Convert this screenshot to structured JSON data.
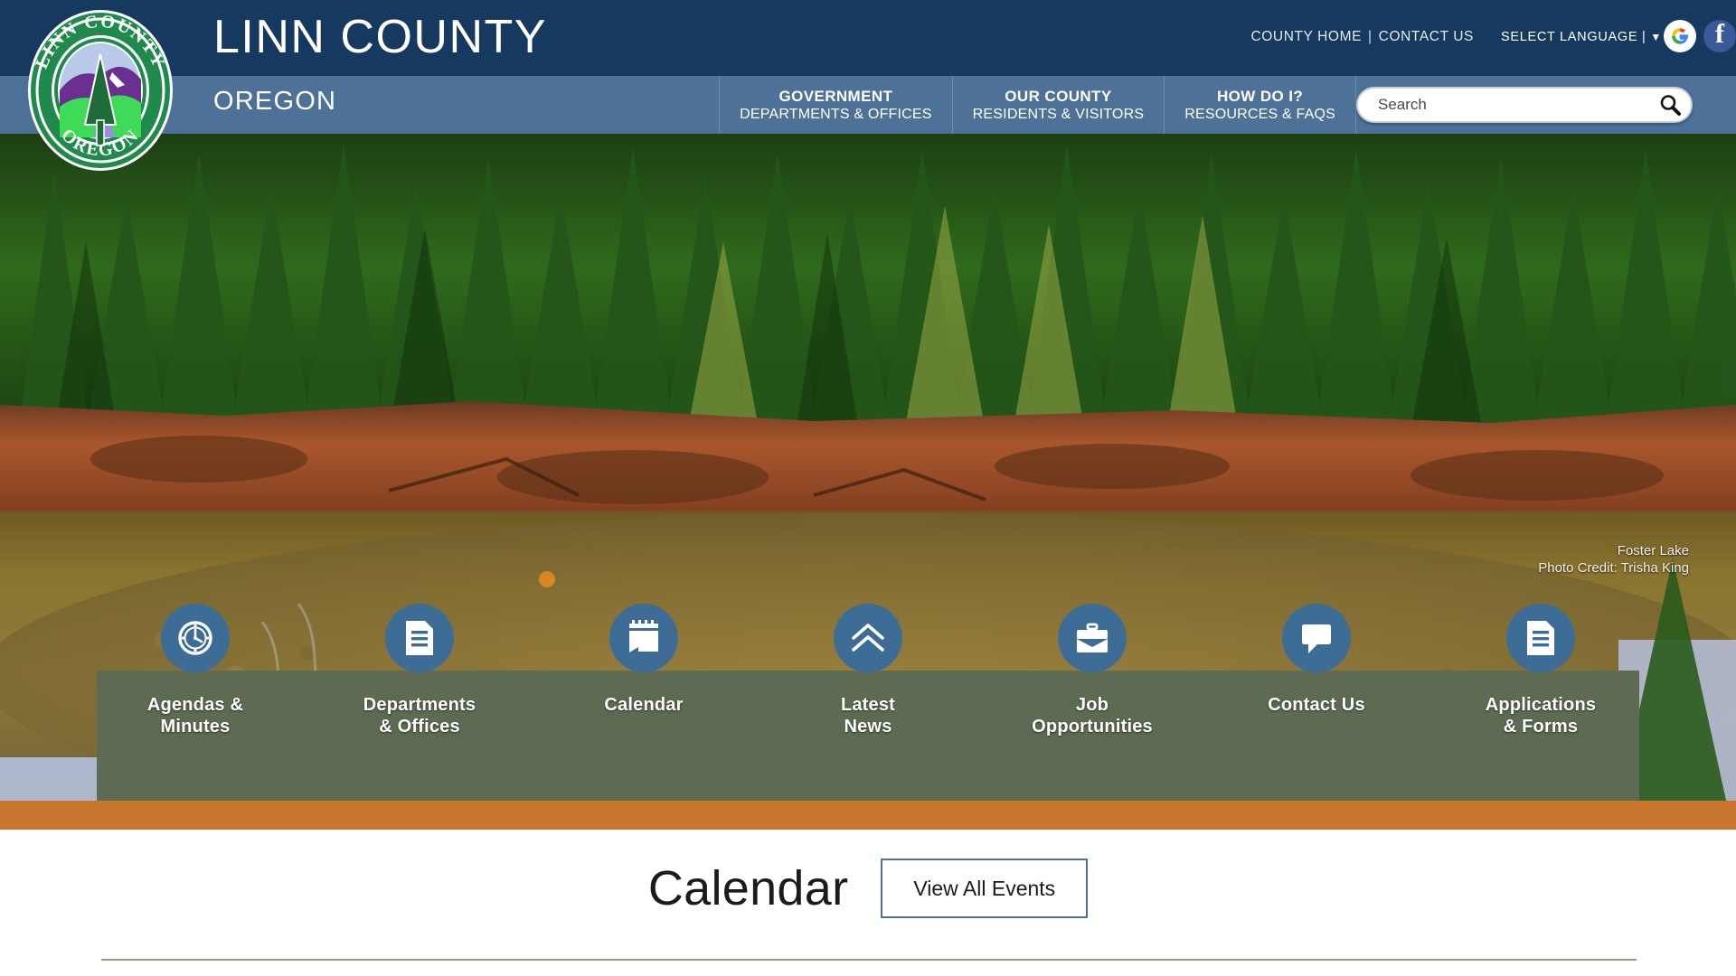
{
  "header": {
    "site_title": "LINN COUNTY",
    "site_subtitle": "OREGON",
    "utility_links": [
      {
        "label": "COUNTY HOME"
      },
      {
        "label": "CONTACT US"
      }
    ],
    "utility_separator": "|",
    "language_label": "SELECT LANGUAGE |",
    "language_caret": "▼",
    "social": [
      {
        "name": "google-icon",
        "label": "G"
      },
      {
        "name": "facebook-icon",
        "label": "f"
      }
    ],
    "seal": {
      "top_text": "LINN COUNTY",
      "bottom_text": "OREGON"
    }
  },
  "nav": {
    "items": [
      {
        "title": "GOVERNMENT",
        "subtitle": "DEPARTMENTS & OFFICES"
      },
      {
        "title": "OUR COUNTY",
        "subtitle": "RESIDENTS & VISITORS"
      },
      {
        "title": "HOW DO I?",
        "subtitle": "RESOURCES & FAQS"
      }
    ]
  },
  "search": {
    "placeholder": "Search",
    "value": "",
    "icon": "search-icon"
  },
  "hero": {
    "photo_caption": "Foster Lake",
    "photo_credit": "Photo Credit: Trisha King"
  },
  "quick_links": [
    {
      "label": "Agendas &\nMinutes",
      "icon": "clock-icon"
    },
    {
      "label": "Departments\n& Offices",
      "icon": "document-icon"
    },
    {
      "label": "Calendar",
      "icon": "calendar-icon"
    },
    {
      "label": "Latest\nNews",
      "icon": "double-chevron-up-icon"
    },
    {
      "label": "Job\nOpportunities",
      "icon": "briefcase-icon"
    },
    {
      "label": "Contact Us",
      "icon": "speech-bubble-icon"
    },
    {
      "label": "Applications\n& Forms",
      "icon": "document-icon"
    }
  ],
  "calendar_section": {
    "title": "Calendar",
    "view_all_label": "View All Events"
  },
  "colors": {
    "topbar": "#163a5f",
    "navbar": "#4d7197",
    "quick_bar": "#5d6b52",
    "accent_orange": "#c8762e",
    "icon_circle": "#3d6c97",
    "rule": "#a89484"
  }
}
